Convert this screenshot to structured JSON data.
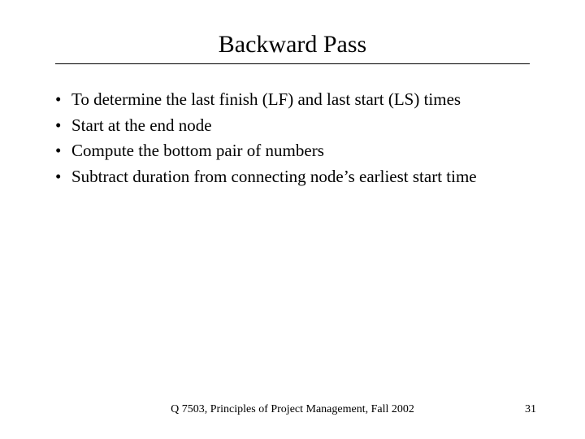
{
  "slide": {
    "title": "Backward Pass",
    "bullets": [
      "To determine the last finish (LF) and last start (LS) times",
      "Start at the end node",
      "Compute the bottom pair of numbers",
      "Subtract duration from connecting node’s earliest start time"
    ],
    "footer": "Q 7503, Principles of Project Management, Fall 2002",
    "page_number": "31"
  }
}
